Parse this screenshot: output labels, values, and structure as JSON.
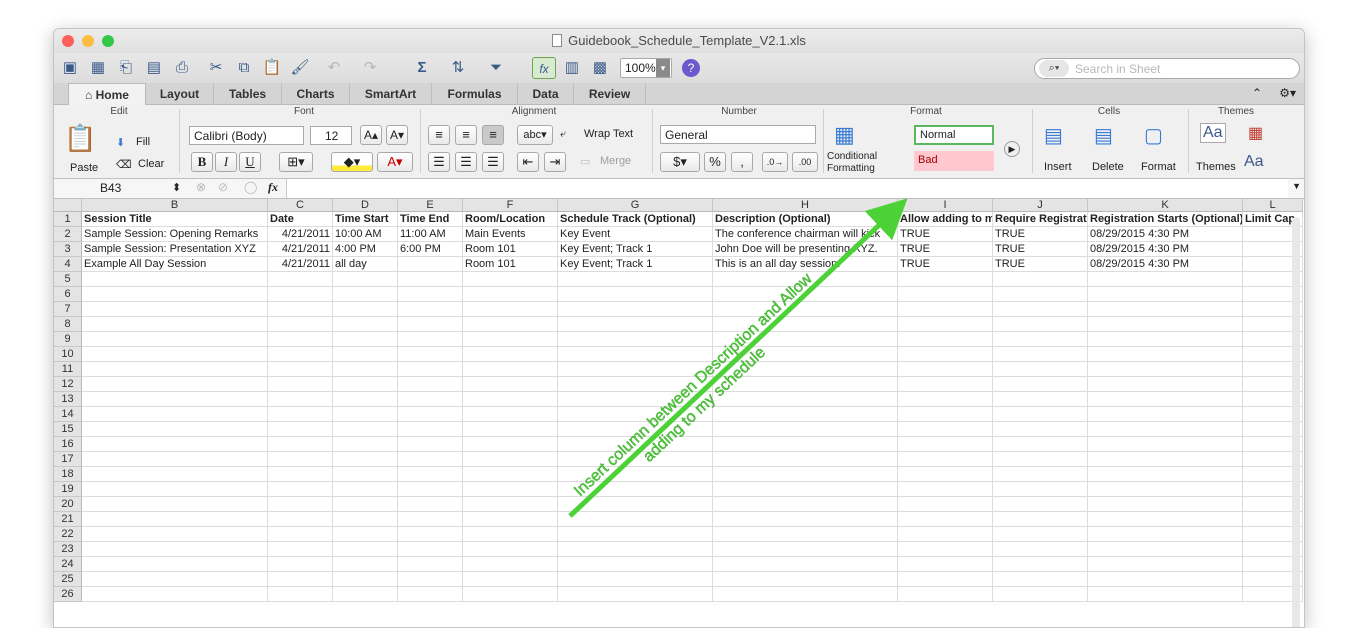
{
  "window": {
    "title": "Guidebook_Schedule_Template_V2.1.xls"
  },
  "toolbar": {
    "zoom": "100%",
    "search_placeholder": "Search in Sheet"
  },
  "tabs": [
    "Home",
    "Layout",
    "Tables",
    "Charts",
    "SmartArt",
    "Formulas",
    "Data",
    "Review"
  ],
  "ribbon": {
    "groups": {
      "edit": "Edit",
      "font": "Font",
      "alignment": "Alignment",
      "number": "Number",
      "format": "Format",
      "cells": "Cells",
      "themes": "Themes"
    },
    "paste": "Paste",
    "fill": "Fill",
    "clear": "Clear",
    "font_name": "Calibri (Body)",
    "font_size": "12",
    "bold": "B",
    "italic": "I",
    "underline": "U",
    "abc": "abc",
    "wrap_text": "Wrap Text",
    "merge": "Merge",
    "number_format": "General",
    "percent": "%",
    "comma": ",",
    "conditional": "Conditional",
    "formatting": "Formatting",
    "normal": "Normal",
    "bad": "Bad",
    "insert": "Insert",
    "delete": "Delete",
    "format_label": "Format",
    "themes": "Themes",
    "aa": "Aa"
  },
  "formula_bar": {
    "cell_ref": "B43",
    "fx": "fx",
    "value": ""
  },
  "columns": [
    {
      "letter": "B",
      "width": 186
    },
    {
      "letter": "C",
      "width": 65
    },
    {
      "letter": "D",
      "width": 65
    },
    {
      "letter": "E",
      "width": 65
    },
    {
      "letter": "F",
      "width": 95
    },
    {
      "letter": "G",
      "width": 155
    },
    {
      "letter": "H",
      "width": 185
    },
    {
      "letter": "I",
      "width": 95
    },
    {
      "letter": "J",
      "width": 95
    },
    {
      "letter": "K",
      "width": 155
    },
    {
      "letter": "L",
      "width": 60
    }
  ],
  "rows": [
    [
      "Session Title",
      "Date",
      "Time Start",
      "Time End",
      "Room/Location",
      "Schedule Track (Optional)",
      "Description (Optional)",
      "Allow adding to my",
      "Require Registration",
      "Registration Starts (Optional)",
      "Limit Cap"
    ],
    [
      "Sample Session:  Opening Remarks",
      "4/21/2011",
      "10:00 AM",
      "11:00 AM",
      "Main Events",
      "Key Event",
      "The conference chairman will kick",
      "TRUE",
      "TRUE",
      "08/29/2015 4:30 PM",
      ""
    ],
    [
      "Sample Session:  Presentation XYZ",
      "4/21/2011",
      "4:00 PM",
      "6:00 PM",
      "Room 101",
      "Key Event; Track 1",
      "John Doe will be presenting XYZ.",
      "TRUE",
      "TRUE",
      "08/29/2015 4:30 PM",
      ""
    ],
    [
      "Example All Day Session",
      "4/21/2011",
      "all day",
      "",
      "Room 101",
      "Key Event; Track 1",
      "This is an all day session.",
      "TRUE",
      "TRUE",
      "08/29/2015 4:30 PM",
      ""
    ]
  ],
  "row_numbers": [
    "1",
    "2",
    "3",
    "4",
    "5",
    "6",
    "7",
    "8",
    "9",
    "10",
    "11",
    "12",
    "13",
    "14",
    "15",
    "16",
    "17",
    "18",
    "19",
    "20",
    "21",
    "22",
    "23",
    "24",
    "25",
    "26"
  ],
  "annotation": {
    "line1": "Insert column between Description and Allow",
    "line2": "adding to my schedule",
    "color": "#4cd137"
  }
}
